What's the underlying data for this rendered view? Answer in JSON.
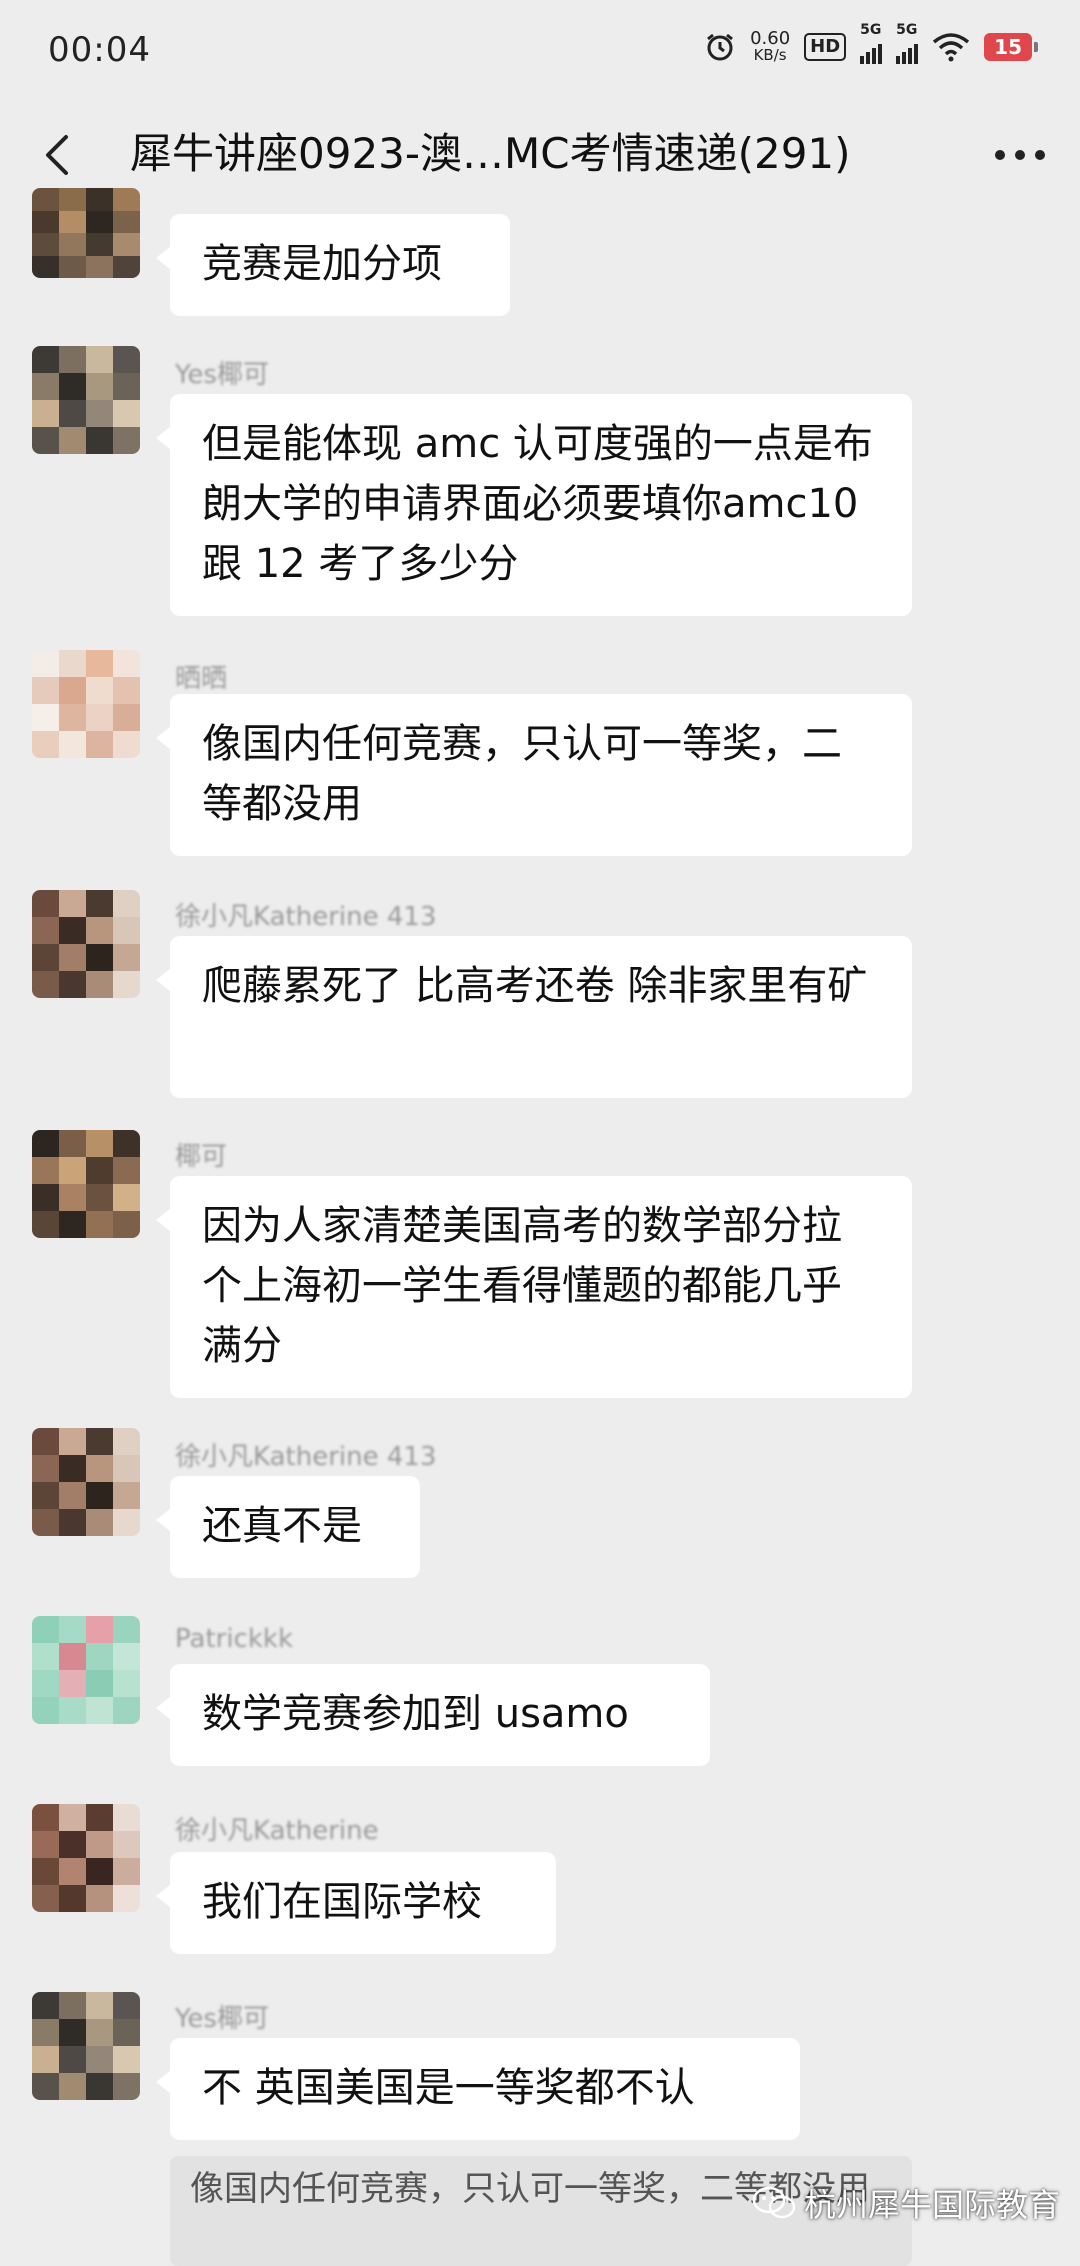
{
  "status_bar": {
    "time": "00:04",
    "speed_value": "0.60",
    "speed_unit": "KB/s",
    "hd_label": "HD",
    "sim1_label": "5G",
    "sim2_label": "5G",
    "battery": "15"
  },
  "header": {
    "title": "犀牛讲座0923-澳…MC考情速递(291)"
  },
  "messages": [
    {
      "sender": "",
      "text": "竞赛是加分项"
    },
    {
      "sender": "Yes椰可",
      "text": "但是能体现 amc 认可度强的一点是布朗大学的申请界面必须要填你amc10 跟 12 考了多少分"
    },
    {
      "sender": "晒晒",
      "text": "像国内任何竞赛，只认可一等奖，二等都没用"
    },
    {
      "sender": "徐小凡Katherine 413",
      "text": "爬藤累死了 比高考还卷 除非家里有矿"
    },
    {
      "sender": "椰可",
      "text": "因为人家清楚美国高考的数学部分拉个上海初一学生看得懂题的都能几乎满分"
    },
    {
      "sender": "徐小凡Katherine 413",
      "text": "还真不是"
    },
    {
      "sender": "Patrickkk",
      "text": "数学竞赛参加到 usamo"
    },
    {
      "sender": "徐小凡Katherine",
      "text": "我们在国际学校"
    },
    {
      "sender": "Yes椰可",
      "text": "不 英国美国是一等奖都不认"
    }
  ],
  "quote": {
    "text": "像国内任何竞赛，只认可一等奖，二等都没用"
  },
  "watermark": {
    "text": "杭州犀牛国际教育"
  },
  "colors": {
    "background": "#ededed",
    "bubble": "#ffffff",
    "battery": "#e0474c"
  }
}
